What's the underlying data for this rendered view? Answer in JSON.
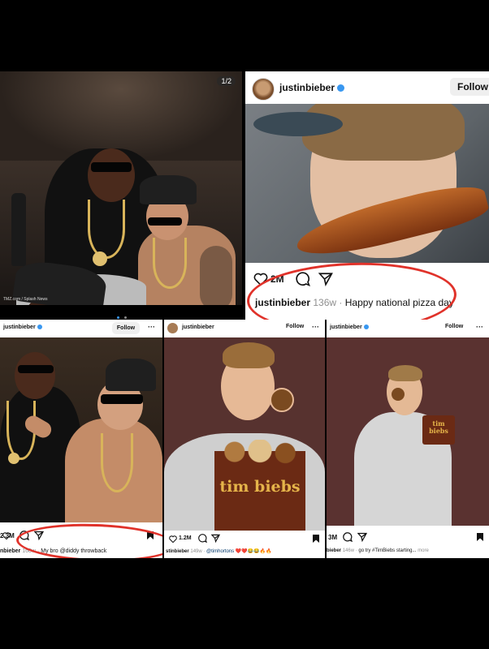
{
  "top_left_post": {
    "page_indicator": "1/2",
    "watermark": "TMZ.com / Splash News"
  },
  "top_right_post": {
    "username": "justinbieber",
    "follow_label": "Follow",
    "likes": "2M",
    "caption_user": "justinbieber",
    "caption_age": "136w",
    "caption_sep": "·",
    "caption_text": "Happy national pizza day"
  },
  "bottom_left_post": {
    "username": "justinbieber",
    "follow_label": "Follow",
    "more": "···",
    "likes": "2.3M",
    "caption_user": "nbieber",
    "caption_age": "168w",
    "caption_sep": "·",
    "caption_text": "My bro @diddy throwback"
  },
  "bottom_mid_post": {
    "username": "justinbieber",
    "follow_label": "Follow",
    "more": "···",
    "likes": "1.2M",
    "caption_user": "stinbieber",
    "caption_age": "149w",
    "caption_sep": "·",
    "caption_text": "@timhortons",
    "emoji": "❤️❤️😂😂🔥🔥",
    "box_text": "tim biebs"
  },
  "bottom_right_post": {
    "username": "justinbieber",
    "follow_label": "Follow",
    "more": "···",
    "likes": "3M",
    "caption_user": "bieber",
    "caption_age": "146w",
    "caption_sep": "·",
    "caption_text": "go try #TimBiebs starting...",
    "caption_more": "more",
    "box_text": "tim biebs"
  },
  "colors": {
    "highlight_ring": "#e0322a",
    "verified": "#3897f0",
    "box_brown": "#6b2a14",
    "box_gold": "#e5b44a"
  }
}
